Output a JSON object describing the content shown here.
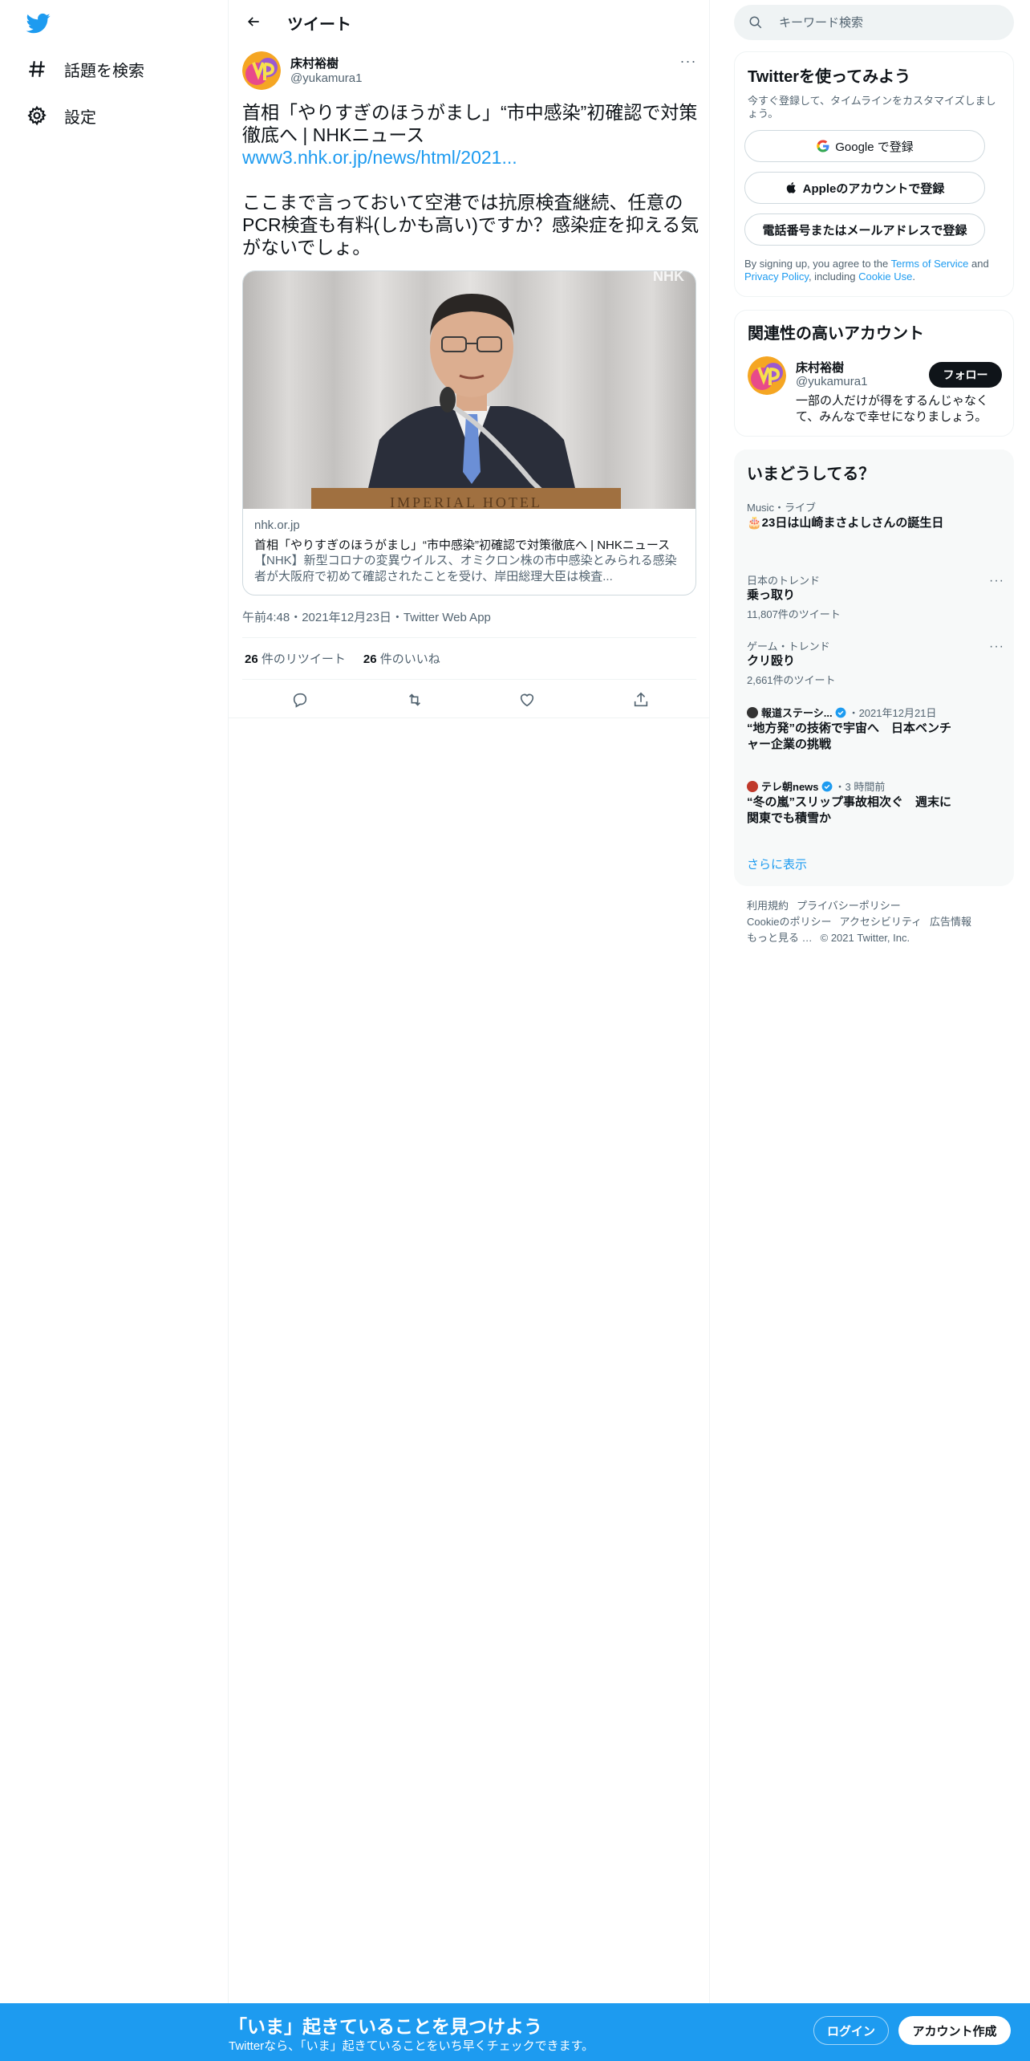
{
  "nav": {
    "items": [
      {
        "label": "話題を検索",
        "icon": "hashtag-icon"
      },
      {
        "label": "設定",
        "icon": "gear-icon"
      }
    ]
  },
  "header": {
    "title": "ツイート"
  },
  "tweet": {
    "author_name": "床村裕樹",
    "author_handle": "@yukamura1",
    "text_line1": "首相「やりすぎのほうがまし」“市中感染”初確認で対策徹底へ | NHKニュース",
    "link": "www3.nhk.or.jp/news/html/2021...",
    "text_line2": "ここまで言っておいて空港では抗原検査継続、任意のPCR検査も有料(しかも高い)ですか？感染症を抑える気がないでしょ。",
    "card": {
      "domain": "nhk.or.jp",
      "title": "首相「やりすぎのほうがまし」“市中感染”初確認で対策徹底へ | NHKニュース",
      "description": "【NHK】新型コロナの変異ウイルス、オミクロン株の市中感染とみられる感染者が大阪府で初めて確認されたことを受け、岸田総理大臣は検査...",
      "image_watermark": "NHK",
      "podium_text": "IMPERIAL HOTEL"
    },
    "timestamp": "午前4:48・2021年12月23日・Twitter Web App",
    "retweets_count": "26",
    "retweets_label": "件のリツイート",
    "likes_count": "26",
    "likes_label": "件のいいね"
  },
  "search": {
    "placeholder": "キーワード検索"
  },
  "signup_panel": {
    "title": "Twitterを使ってみよう",
    "subtitle": "今すぐ登録して、タイムラインをカスタマイズしましょう。",
    "google_label": "Google で登録",
    "apple_label": "Appleのアカウントで登録",
    "phone_label": "電話番号またはメールアドレスで登録",
    "terms_prefix": "By signing up, you agree to the ",
    "terms_link": "Terms of Service",
    "terms_and": " and ",
    "privacy_link": "Privacy Policy",
    "terms_including": ", including ",
    "cookie_link": "Cookie Use",
    "terms_end": "."
  },
  "related": {
    "title": "関連性の高いアカウント",
    "name": "床村裕樹",
    "handle": "@yukamura1",
    "follow_label": "フォロー",
    "bio": "一部の人だけが得をするんじゃなくて、みんなで幸せになりましょう。"
  },
  "trends": {
    "title": "いまどうしてる？",
    "items": [
      {
        "meta": "Music・ライブ",
        "name": "🎂23日は山崎まさよしさんの誕生日"
      },
      {
        "meta": "日本のトレンド",
        "name": "乗っ取り",
        "count": "11,807件のツイート"
      },
      {
        "meta": "ゲーム・トレンド",
        "name": "クリ殴り",
        "count": "2,661件のツイート"
      },
      {
        "source": "報道ステーシ...",
        "date": "・2021年12月21日",
        "name": "“地方発”の技術で宇宙へ　日本ベンチャー企業の挑戦"
      },
      {
        "source": "テレ朝news",
        "date": "・3 時間前",
        "name": "“冬の嵐”スリップ事故相次ぐ　週末に関東でも積雪か"
      }
    ],
    "show_more": "さらに表示"
  },
  "footer": {
    "links": [
      "利用規約",
      "プライバシーポリシー",
      "Cookieのポリシー",
      "アクセシビリティ",
      "広告情報",
      "もっと見る …",
      "© 2021 Twitter, Inc."
    ]
  },
  "banner": {
    "title": "「いま」起きていることを見つけよう",
    "subtitle": "Twitterなら、「いま」起きていることをいち早くチェックできます。",
    "login_label": "ログイン",
    "signup_label": "アカウント作成"
  },
  "colors": {
    "accent": "#1d9bf0",
    "text": "#0f1419",
    "secondary": "#536471",
    "banner": "#1d9bf0"
  }
}
